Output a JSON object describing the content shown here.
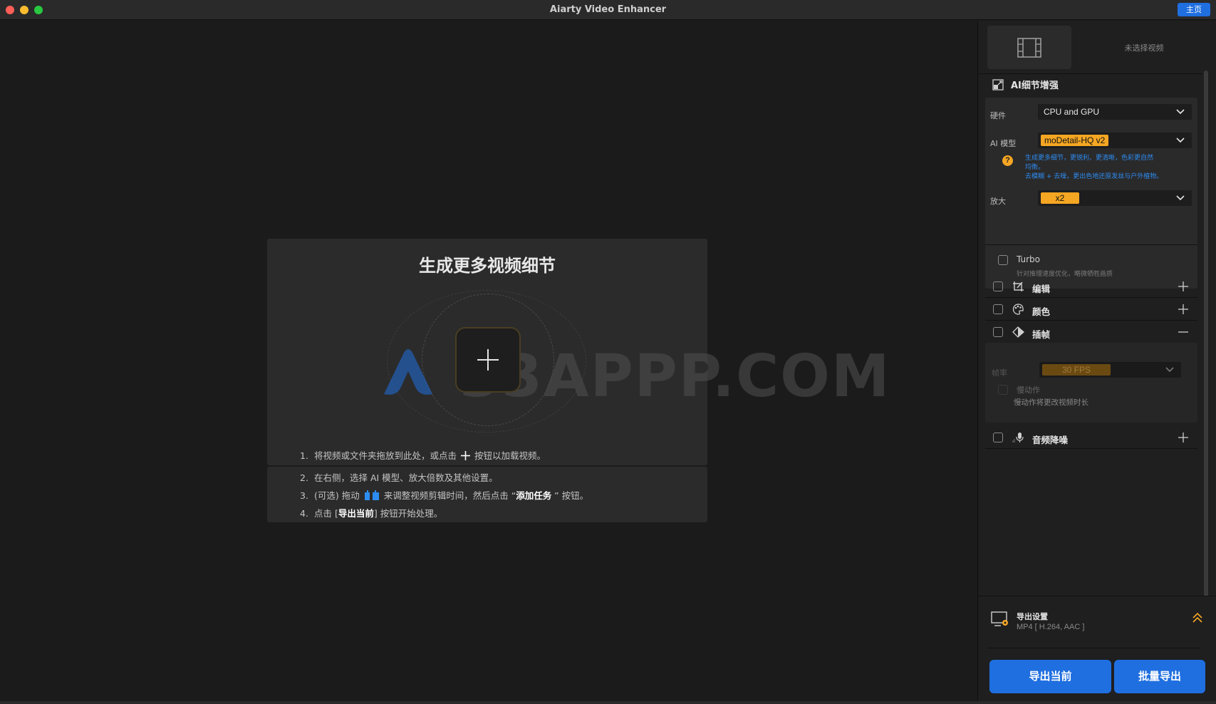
{
  "window": {
    "title": "Aiarty Video Enhancer",
    "home_label": "主页"
  },
  "main": {
    "headline": "生成更多视频细节",
    "watermark": "33APPP.COM",
    "steps": [
      {
        "num": "1.",
        "pre": "将视频或文件夹拖放到此处，或点击",
        "post": "按钮以加载视频。"
      },
      {
        "num": "2.",
        "text": "在右侧，选择 AI 模型、放大倍数及其他设置。"
      },
      {
        "num": "3.",
        "pre": "(可选) 拖动",
        "mid": "来调整视频剪辑时间，然后点击 “",
        "bold": "添加任务",
        "post": " ” 按钮。"
      },
      {
        "num": "4.",
        "pre": "点击 [",
        "bold": "导出当前",
        "post": "] 按钮开始处理。"
      }
    ]
  },
  "panel": {
    "preview_label": "未选择视频",
    "ai_section": {
      "title": "AI细节增强",
      "hardware_label": "硬件",
      "hardware_value": "CPU and GPU",
      "model_label": "AI 模型",
      "model_value": "moDetail-HQ  v2",
      "model_desc_1": "生成更多细节，更锐利、更清晰，色彩更自然",
      "model_desc_2": "均衡。",
      "model_desc_3": "去模糊 + 去噪，更出色地还原发丝与户外植物。",
      "scale_label": "放大",
      "scale_value": "x2",
      "turbo_label": "Turbo",
      "turbo_desc": "针对推理速度优化，略微牺牲画质"
    },
    "options": [
      {
        "name": "编辑",
        "toggle": "+"
      },
      {
        "name": "颜色",
        "toggle": "+"
      },
      {
        "name": "插帧",
        "toggle": "−"
      },
      {
        "name": "音频降噪",
        "toggle": "+"
      }
    ],
    "frame_interp": {
      "rate_label": "帧率",
      "rate_value": "30 FPS",
      "slowmo_label": "慢动作",
      "slowmo_desc": "慢动作将更改视频时长"
    },
    "export": {
      "title": "导出设置",
      "format": "MP4 [ H.264, AAC ]",
      "export_current": "导出当前",
      "batch_export": "批量导出"
    }
  },
  "colors": {
    "accent_blue": "#1f6fe0",
    "accent_orange": "#f5a623",
    "desc_blue": "#2d8cf0"
  }
}
